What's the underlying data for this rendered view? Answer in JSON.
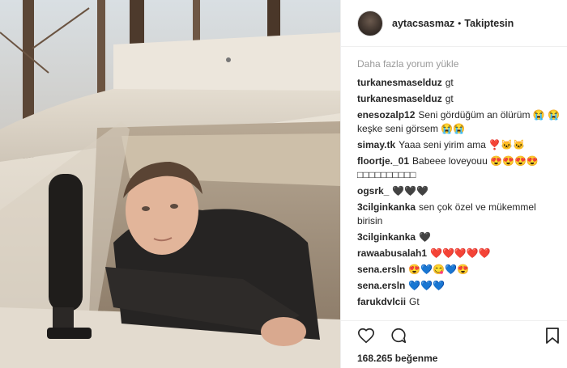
{
  "header": {
    "username": "aytacsasmaz",
    "separator": "•",
    "follow_label": "Takiptesin"
  },
  "comments_panel": {
    "load_more": "Daha fazla yorum yükle",
    "items": [
      {
        "user": "turkanesmaselduz",
        "text": "gt"
      },
      {
        "user": "turkanesmaselduz",
        "text": "gt"
      },
      {
        "user": "enesozalp12",
        "text": "Seni gördüğüm an ölürüm 😭 😭 keşke seni görsem 😭😭"
      },
      {
        "user": "simay.tk",
        "text": "Yaaa seni yirim ama ❣️🐱🐱"
      },
      {
        "user": "floortje._01",
        "text": "Babeee loveyouu 😍😍😍😍 □□□□□□□□□□"
      },
      {
        "user": "ogsrk_",
        "text": "🖤🖤🖤"
      },
      {
        "user": "3cilginkanka",
        "text": "sen çok özel ve mükemmel birisin"
      },
      {
        "user": "3cilginkanka",
        "text": "🖤"
      },
      {
        "user": "rawaabusalah1",
        "text": "❤️❤️❤️❤️❤️"
      },
      {
        "user": "sena.ersln",
        "text": "😍💙😋💙😍"
      },
      {
        "user": "sena.ersln",
        "text": "💙💙💙"
      },
      {
        "user": "farukdvlcii",
        "text": "Gt"
      }
    ]
  },
  "footer": {
    "likes_count": "168.265",
    "likes_label": "beğenme"
  },
  "icons": {
    "like": "heart-icon",
    "comment": "comment-icon",
    "save": "bookmark-icon"
  }
}
